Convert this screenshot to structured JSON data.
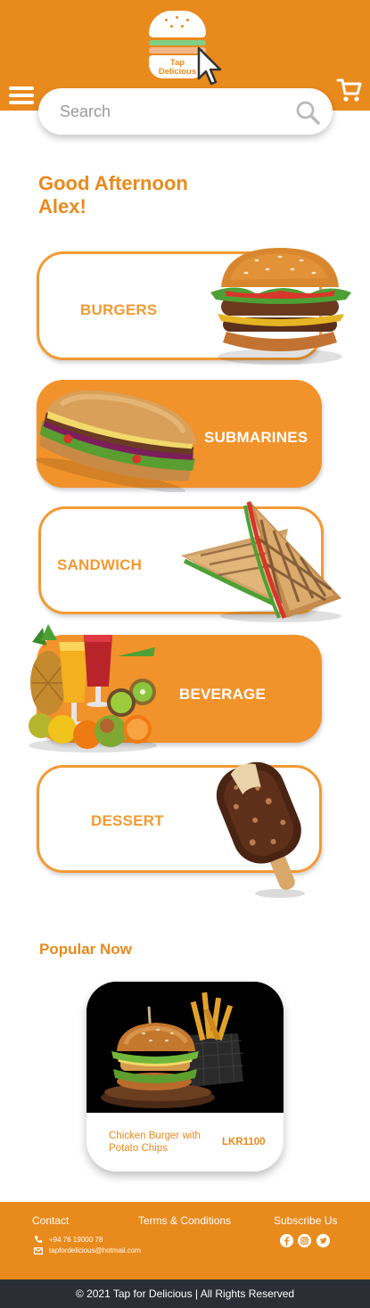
{
  "header": {
    "logo_text_line1": "Tap",
    "logo_text_line2": "Delicious",
    "menu_icon": "hamburger-menu-icon",
    "cart_icon": "shopping-cart-icon"
  },
  "search": {
    "placeholder": "Search",
    "value": "",
    "icon": "search-icon"
  },
  "greeting": {
    "line1": "Good Afternoon",
    "line2": "Alex!"
  },
  "categories": [
    {
      "label": "BURGERS",
      "style": "outline"
    },
    {
      "label": "SUBMARINES",
      "style": "filled"
    },
    {
      "label": "SANDWICH",
      "style": "outline"
    },
    {
      "label": "BEVERAGE",
      "style": "filled"
    },
    {
      "label": "DESSERT",
      "style": "outline"
    }
  ],
  "popular": {
    "title": "Popular Now",
    "items": [
      {
        "name": "Chicken Burger with Potato Chips",
        "price": "LKR1100"
      }
    ]
  },
  "footer": {
    "contact_heading": "Contact",
    "phone": "+94 76 19000 78",
    "email": "tapfordelicious@hotmail.com",
    "terms_label": "Terms & Conditions",
    "subscribe_heading": "Subscribe Us",
    "social_icons": [
      "facebook-icon",
      "instagram-icon",
      "twitter-icon"
    ],
    "copyright": "© 2021 Tap for Delicious | All Rights Reserved"
  },
  "colors": {
    "brand_orange": "#e98a1d",
    "card_orange": "#f2922b",
    "footer_dark": "#2b2e35"
  }
}
